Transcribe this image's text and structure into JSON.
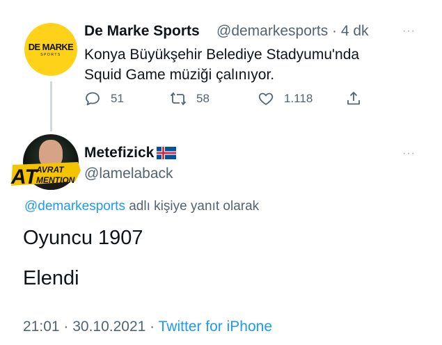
{
  "tweet1": {
    "avatar": {
      "logo_main": "DE MARKE",
      "logo_sub": "SPORTS"
    },
    "display_name": "De Marke Sports",
    "handle_time": "@demarkesports · 4 dk",
    "more": "···",
    "text_line1": "Konya Büyükşehir Belediye Stadyumu'nda",
    "text_line2": "Squid Game müziği çalınıyor.",
    "actions": {
      "reply_count": "51",
      "retweet_count": "58",
      "like_count": "1.118"
    }
  },
  "tweet2": {
    "avatar_badge": {
      "big": "AT",
      "top": "AVRAT",
      "bottom": "MENTION"
    },
    "display_name": "Metefizick",
    "handle": "@lamelaback",
    "more": "···",
    "reply_mention": "@demarkesports",
    "reply_suffix": " adlı kişiye yanıt olarak",
    "text_line1": "Oyuncu 1907",
    "text_line2": "Elendi",
    "time_date": "21:01 · 30.10.2021 · ",
    "source": "Twitter for iPhone"
  },
  "colors": {
    "link": "#1d9bf0",
    "secondary": "#536471",
    "brand_yellow": "#ffd21a"
  }
}
